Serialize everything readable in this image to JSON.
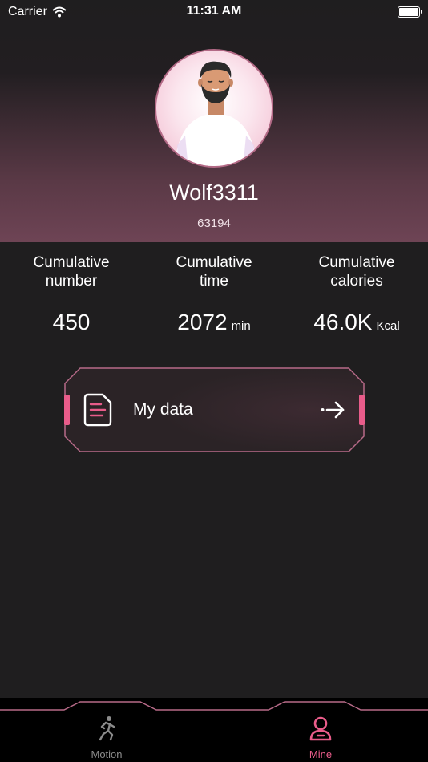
{
  "status_bar": {
    "carrier": "Carrier",
    "time": "11:31 AM"
  },
  "profile": {
    "username": "Wolf3311",
    "user_id": "63194",
    "avatar_icon": "bearded-man-avatar"
  },
  "stats": [
    {
      "label_line1": "Cumulative",
      "label_line2": "number",
      "value": "450",
      "unit": ""
    },
    {
      "label_line1": "Cumulative",
      "label_line2": "time",
      "value": "2072",
      "unit": "min"
    },
    {
      "label_line1": "Cumulative",
      "label_line2": "calories",
      "value": "46.0K",
      "unit": "Kcal"
    }
  ],
  "my_data": {
    "label": "My data",
    "icon": "document-icon",
    "action_icon": "arrow-right-icon"
  },
  "tabs": [
    {
      "label": "Motion",
      "icon": "running-icon",
      "active": false
    },
    {
      "label": "Mine",
      "icon": "user-icon",
      "active": true
    }
  ],
  "colors": {
    "accent": "#e95c8a",
    "background": "#1f1e1f",
    "header_pink": "#6e4455"
  }
}
